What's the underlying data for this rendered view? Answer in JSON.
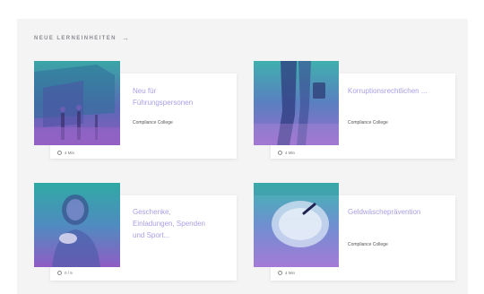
{
  "section": {
    "title": "NEUE LERNEINHEITEN",
    "arrow_icon": "arrow-right-icon"
  },
  "cards": [
    {
      "title": "Neu für Führungspersonen",
      "org": "Compliance College",
      "meta": "4 Min"
    },
    {
      "title": "Korruptionsrechtlichen ...",
      "org": "Compliance College",
      "meta": "4 Min"
    },
    {
      "title": "Geschenke, Einladungen, Spenden und Sport...",
      "org": "",
      "meta": "0 / 5"
    },
    {
      "title": "Geldwäscheprävention",
      "org": "Compliance College",
      "meta": "4 Min"
    }
  ],
  "colors": {
    "accent": "#a8a0e6",
    "panel": "#f4f4f5"
  }
}
